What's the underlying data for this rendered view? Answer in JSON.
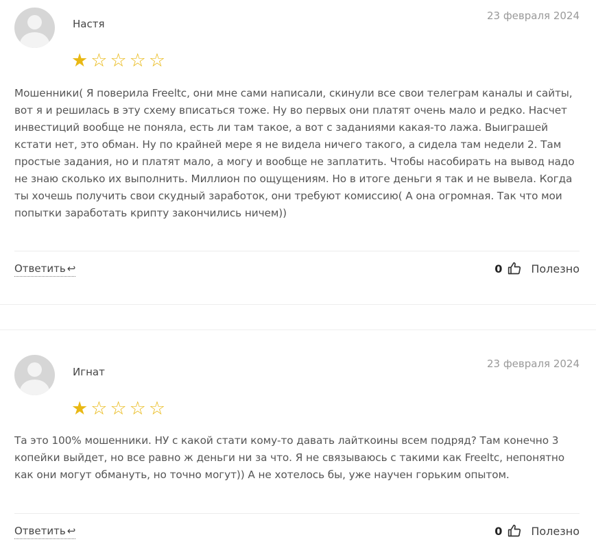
{
  "reviews": [
    {
      "author": "Настя",
      "date": "23 февраля 2024",
      "rating": 1,
      "max_rating": 5,
      "text": "Мошенники( Я поверила Freeltc, они мне сами написали, скинули все свои телеграм каналы и сайты, вот я и решилась в эту схему вписаться тоже. Ну во первых они платят очень мало и редко. Насчет инвестиций вообще не поняла, есть ли там такое, а вот с заданиями какая-то лажа. Выиграшей кстати нет, это обман. Ну по крайней мере я не видела ничего такого, а сидела там недели 2. Там простые задания, но и платят мало, а могу и вообще не заплатить. Чтобы насобирать на вывод надо не знаю сколько их выполнить. Миллион по ощущениям. Но в итоге деньги я так и не вывела. Когда ты хочешь получить свои скудный заработок, они требуют комиссию( А она огромная. Так что мои попытки заработать крипту закончились ничем))",
      "reply_label": "Ответить",
      "useful_count": "0",
      "useful_label": "Полезно"
    },
    {
      "author": "Игнат",
      "date": "23 февраля 2024",
      "rating": 1,
      "max_rating": 5,
      "text": "Та это 100% мошенники. НУ с какой стати кому-то давать лайткоины всем подряд? Там конечно 3 копейки выйдет, но все равно ж деньги ни за что. Я не связываюсь с такими как Freeltc, непонятно как они могут обмануть, но точно могут)) А не хотелось бы, уже научен горьким опытом.",
      "reply_label": "Ответить",
      "useful_count": "0",
      "useful_label": "Полезно"
    }
  ],
  "icons": {
    "avatar": "user-avatar-icon",
    "star": "star-icon",
    "reply": "reply-arrow-icon",
    "thumb": "thumbs-up-icon"
  },
  "colors": {
    "star": "#e9b814",
    "avatar": "#d6d6d6",
    "date": "#999999"
  }
}
